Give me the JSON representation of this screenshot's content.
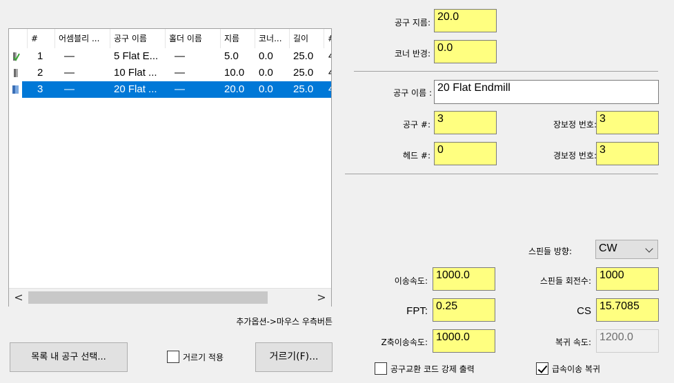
{
  "tool_list": {
    "columns": [
      "#",
      "어셈블리 ...",
      "공구 이름",
      "홀더 이름",
      "지름",
      "코너...",
      "길이",
      "#"
    ],
    "rows": [
      {
        "num": "1",
        "assembly": "—",
        "name": "5 Flat E...",
        "holder": "—",
        "diameter": "5.0",
        "corner": "0.0",
        "length": "25.0",
        "flutes": "4",
        "icon": "tool-check-icon"
      },
      {
        "num": "2",
        "assembly": "—",
        "name": "10 Flat ...",
        "holder": "—",
        "diameter": "10.0",
        "corner": "0.0",
        "length": "25.0",
        "flutes": "4",
        "icon": "tool-icon"
      },
      {
        "num": "3",
        "assembly": "—",
        "name": "20 Flat ...",
        "holder": "—",
        "diameter": "20.0",
        "corner": "0.0",
        "length": "25.0",
        "flutes": "4",
        "icon": "tool-icon",
        "selected": true
      }
    ],
    "scroll_left": "<",
    "scroll_right": ">"
  },
  "hint": "추가옵션->마우스 우측버튼",
  "buttons": {
    "select_tool": "목록 내 공구 선택...",
    "apply_filter": "거르기 적용",
    "filter": "거르기(F)..."
  },
  "form": {
    "tool_diameter_label": "공구 지름:",
    "tool_diameter": "20.0",
    "corner_radius_label": "코너 반경:",
    "corner_radius": "0.0",
    "tool_name_label": "공구 이름 :",
    "tool_name": "20 Flat Endmill",
    "tool_num_label": "공구 #:",
    "tool_num": "3",
    "length_offset_label": "장보정 번호:",
    "length_offset": "3",
    "head_num_label": "헤드 #:",
    "head_num": "0",
    "dia_offset_label": "경보정 번호:",
    "dia_offset": "3",
    "spindle_dir_label": "스핀들 방향:",
    "spindle_dir": "CW",
    "feed_label": "이송속도:",
    "feed": "1000.0",
    "spindle_speed_label": "스핀들 회전수:",
    "spindle_speed": "1000",
    "fpt_label": "FPT:",
    "fpt": "0.25",
    "cs_label": "CS",
    "cs": "15.7085",
    "plunge_label": "Z축이송속도:",
    "plunge": "1000.0",
    "retract_label": "복귀 속도:",
    "retract": "1200.0",
    "force_tc_label": "공구교환 코드 강제 출력",
    "rapid_retract_label": "급속이송 복귀"
  },
  "colors": {
    "input_bg": "#ffff80",
    "selection": "#0078d7"
  }
}
